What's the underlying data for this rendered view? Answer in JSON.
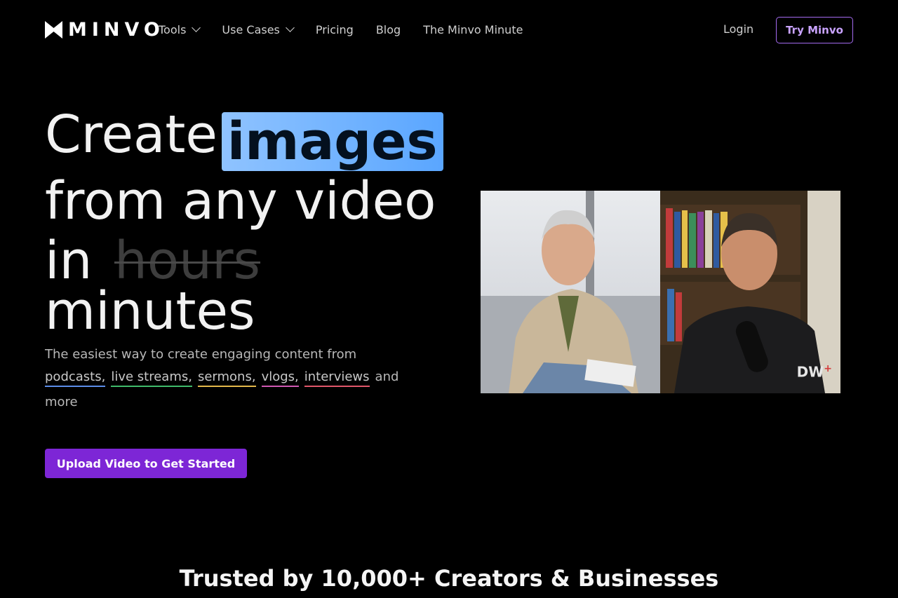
{
  "brand": {
    "name": "MINVO"
  },
  "nav": {
    "items": [
      {
        "label": "Tools",
        "has_dropdown": true
      },
      {
        "label": "Use Cases",
        "has_dropdown": true
      },
      {
        "label": "Pricing",
        "has_dropdown": false
      },
      {
        "label": "Blog",
        "has_dropdown": false
      },
      {
        "label": "The Minvo Minute",
        "has_dropdown": false
      }
    ],
    "login_label": "Login",
    "try_label": "Try Minvo"
  },
  "hero": {
    "word_create": "Create",
    "word_highlight": "images",
    "line2": "from any video",
    "word_in": "in",
    "word_struck": "hours",
    "line4": "minutes",
    "desc_intro": "The easiest way to create engaging content from",
    "tags": [
      "podcasts,",
      "live streams,",
      "sermons,",
      "vlogs,",
      "interviews"
    ],
    "desc_and": "and",
    "desc_more": "more",
    "cta_label": "Upload Video to Get Started"
  },
  "video": {
    "watermark": "DW",
    "watermark_plus": "+"
  },
  "trusted": {
    "heading": "Trusted by 10,000+ Creators & Businesses"
  },
  "colors": {
    "accent": "#7d26d6",
    "highlight": "#5aa6ff",
    "tag_podcasts": "#5b8ce8",
    "tag_live_streams": "#3fba6a",
    "tag_sermons": "#e3b84a",
    "tag_vlogs": "#d058b2",
    "tag_interviews": "#e0566a"
  }
}
